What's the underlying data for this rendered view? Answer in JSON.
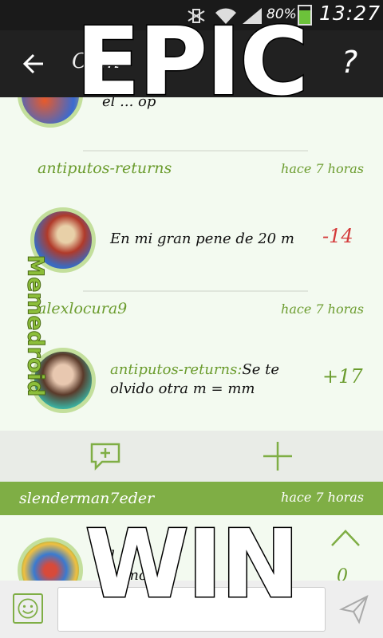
{
  "status_bar": {
    "battery_percent": "80%",
    "clock": "13:27"
  },
  "app_bar": {
    "title": "Com",
    "back_icon": "arrow-left-icon",
    "help_icon": "question-mark-icon"
  },
  "comments": [
    {
      "partial_text": "el ... op"
    },
    {
      "username": "antiputos-returns",
      "time": "hace 7 horas",
      "text": "En mi gran pene de 20 m",
      "votes": "-14"
    },
    {
      "username": "alexlocura9",
      "time": "hace 7 horas",
      "mention": "antiputos-returns:",
      "text": "Se te olvido otra m = mm",
      "votes": "+17"
    }
  ],
  "actions": {
    "add_comment_icon": "add-comment-icon",
    "add_icon": "plus-icon"
  },
  "next_post": {
    "username": "slenderman7eder",
    "time": "hace 7 horas",
    "text_line1": "cl",
    "text_line2": "ph              mo",
    "votes": "0",
    "upvote_icon": "chevron-up-icon"
  },
  "compose": {
    "emoji_icon": "smiley-icon",
    "send_icon": "send-icon",
    "value": ""
  },
  "overlay": {
    "top_text": "EPIC",
    "bottom_text": "WIN",
    "watermark": "Memedroid"
  },
  "colors": {
    "accent": "#7fae45",
    "negative": "#d43a3a",
    "appbar": "#212121"
  }
}
